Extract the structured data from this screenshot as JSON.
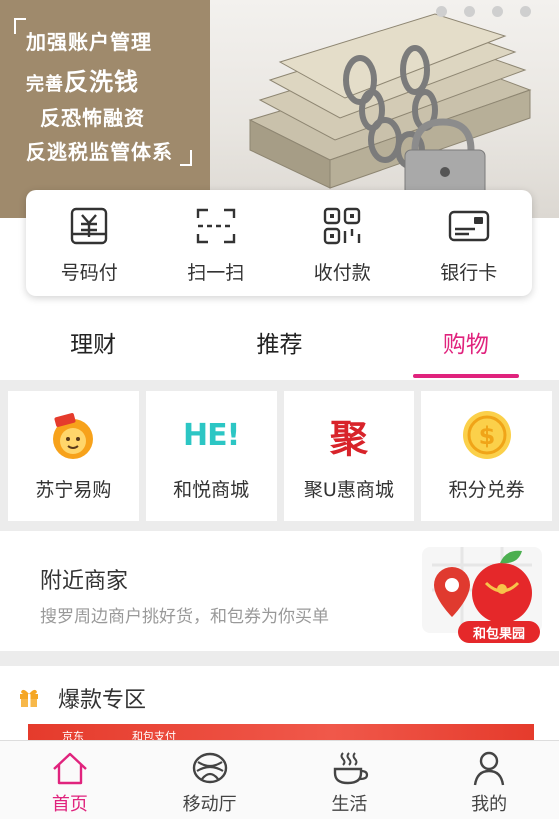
{
  "banner": {
    "line1": "加强账户管理",
    "line2_prefix": "完善",
    "line2_emph": "反洗钱",
    "line3": "反恐怖融资",
    "line4": "反逃税监管体系"
  },
  "quick_actions": [
    {
      "label": "号码付",
      "icon": "yuan-receipt-icon"
    },
    {
      "label": "扫一扫",
      "icon": "scan-icon"
    },
    {
      "label": "收付款",
      "icon": "qr-code-icon"
    },
    {
      "label": "银行卡",
      "icon": "bank-card-icon"
    }
  ],
  "tabs": [
    {
      "label": "理财",
      "active": false
    },
    {
      "label": "推荐",
      "active": false
    },
    {
      "label": "购物",
      "active": true
    }
  ],
  "shops": [
    {
      "label": "苏宁易购",
      "icon": "suning-lion-icon"
    },
    {
      "label": "和悦商城",
      "icon": "he-logo-icon",
      "logo_text": "HE!"
    },
    {
      "label": "聚U惠商城",
      "icon": "ju-logo-icon",
      "logo_text": "聚"
    },
    {
      "label": "积分兑券",
      "icon": "coin-icon",
      "logo_text": "$"
    }
  ],
  "nearby": {
    "title": "附近商家",
    "subtitle": "搜罗周边商户挑好货，和包券为你买单",
    "orchard_label": "和包果园"
  },
  "hot_zone": {
    "title": "爆款专区",
    "banner_text_1": "京东",
    "banner_text_2": "和包支付"
  },
  "bottom_nav": [
    {
      "label": "首页",
      "icon": "home-icon",
      "active": true
    },
    {
      "label": "移动厅",
      "icon": "china-mobile-icon",
      "active": false
    },
    {
      "label": "生活",
      "icon": "coffee-cup-icon",
      "active": false
    },
    {
      "label": "我的",
      "icon": "person-icon",
      "active": false
    }
  ],
  "colors": {
    "accent": "#e0237d",
    "banner_brown": "#9f8a6c",
    "he_teal": "#2cc6c4",
    "ju_red": "#d8232a",
    "coin_gold": "#f5b622"
  }
}
